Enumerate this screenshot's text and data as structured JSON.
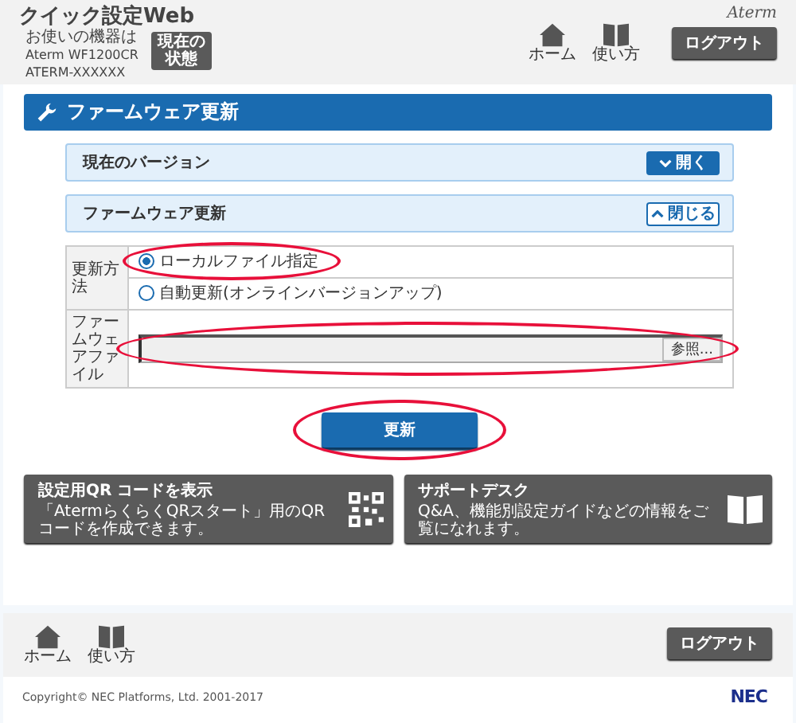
{
  "header": {
    "title": "クイック設定Web",
    "device_lines": [
      "お使いの機器は",
      "Aterm WF1200CR",
      "ATERM-XXXXXX"
    ],
    "status_button": "現在の状態",
    "brand": "Aterm",
    "nav": [
      {
        "kind": "home",
        "label": "ホーム"
      },
      {
        "kind": "book",
        "label": "使い方"
      }
    ],
    "logout": "ログアウト"
  },
  "page_title": "ファームウェア更新",
  "sections": [
    {
      "title": "現在のバージョン",
      "expanded": false,
      "toggle": "開く"
    },
    {
      "title": "ファームウェア更新",
      "expanded": true,
      "toggle": "閉じる"
    }
  ],
  "form": {
    "method_label": "更新方法",
    "options": [
      {
        "label": "ローカルファイル指定",
        "selected": true,
        "highlight": true
      },
      {
        "label": "自動更新(オンラインバージョンアップ)",
        "selected": false,
        "highlight": false
      }
    ],
    "file_label": "ファームウェアファイル",
    "browse": "参照...",
    "file_highlight": true
  },
  "update_button": {
    "label": "更新",
    "highlight": true
  },
  "cards": [
    {
      "kind": "qr",
      "title": "設定用QR コードを表示",
      "text": "「AtermらくらくQRスタート」用のQRコードを作成できます。"
    },
    {
      "kind": "book",
      "title": "サポートデスク",
      "text": "Q&A、機能別設定ガイドなどの情報をご覧になれます。"
    }
  ],
  "footer": {
    "nav": [
      {
        "kind": "home",
        "label": "ホーム"
      },
      {
        "kind": "book",
        "label": "使い方"
      }
    ],
    "logout": "ログアウト",
    "copyright": "Copyright© NEC Platforms, Ltd. 2001-2017",
    "logo": "NEC"
  }
}
